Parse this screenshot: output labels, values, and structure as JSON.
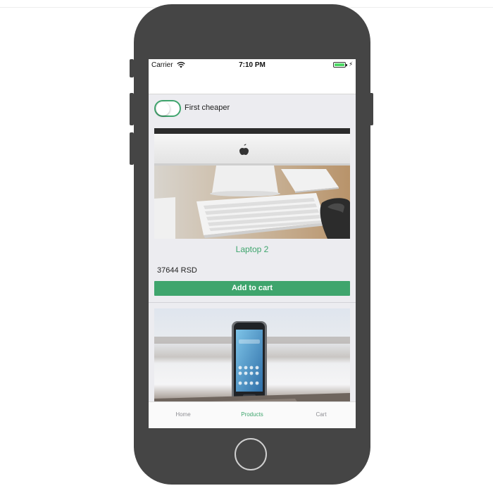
{
  "status_bar": {
    "carrier": "Carrier",
    "time": "7:10 PM",
    "battery_color": "#4cd964"
  },
  "filter": {
    "label": "First cheaper",
    "enabled": false,
    "accent_color": "#3fa56d"
  },
  "products": [
    {
      "image": "imac-keyboard-photo",
      "name": "Laptop 2",
      "price": "37644 RSD",
      "button_label": "Add to cart"
    },
    {
      "image": "smartphone-photo"
    }
  ],
  "tabs": [
    {
      "label": "Home",
      "active": false
    },
    {
      "label": "Products",
      "active": true
    },
    {
      "label": "Cart",
      "active": false
    }
  ]
}
